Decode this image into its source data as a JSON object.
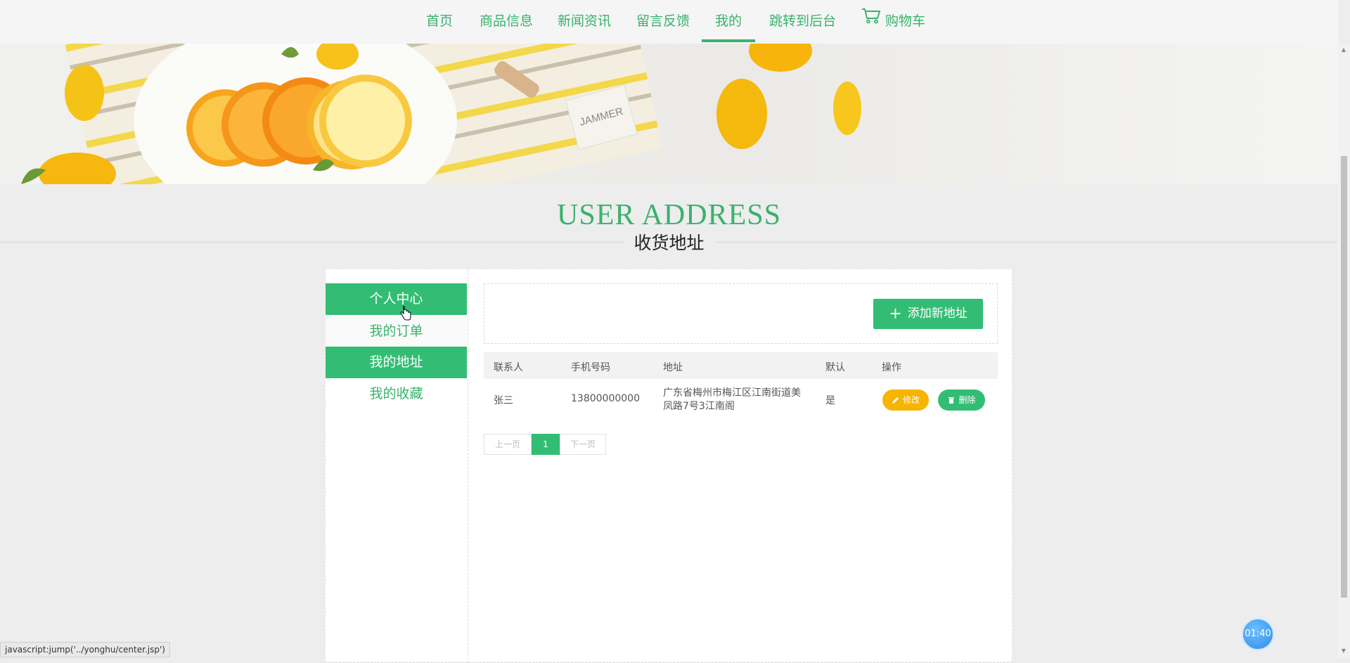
{
  "nav": {
    "items": [
      {
        "label": "首页"
      },
      {
        "label": "商品信息"
      },
      {
        "label": "新闻资讯"
      },
      {
        "label": "留言反馈"
      },
      {
        "label": "我的"
      },
      {
        "label": "跳转到后台"
      },
      {
        "label": "购物车",
        "icon": "cart-icon"
      }
    ],
    "active": "我的"
  },
  "heading": {
    "title": "USER ADDRESS",
    "subtitle": "收货地址"
  },
  "sidebar": {
    "items": [
      {
        "label": "个人中心",
        "state": "active"
      },
      {
        "label": "我的订单",
        "state": "normal"
      },
      {
        "label": "我的地址",
        "state": "active"
      },
      {
        "label": "我的收藏",
        "state": "normal"
      }
    ]
  },
  "toolbar": {
    "add_label": "添加新地址",
    "add_icon": "plus-icon"
  },
  "table": {
    "headers": [
      "联系人",
      "手机号码",
      "地址",
      "默认",
      "操作"
    ],
    "rows": [
      {
        "contact": "张三",
        "phone": "13800000000",
        "address": "广东省梅州市梅江区江南街道美凤路7号3江南阁",
        "default": "是",
        "edit_label": "修改",
        "delete_label": "删除"
      }
    ]
  },
  "pagination": {
    "prev": "上一页",
    "current": "1",
    "next": "下一页"
  },
  "timer": "01:40",
  "status_bar": "javascript:jump('../yonghu/center.jsp')",
  "colors": {
    "accent": "#33bd74",
    "nav_text": "#39b26d",
    "edit": "#f7b400"
  }
}
